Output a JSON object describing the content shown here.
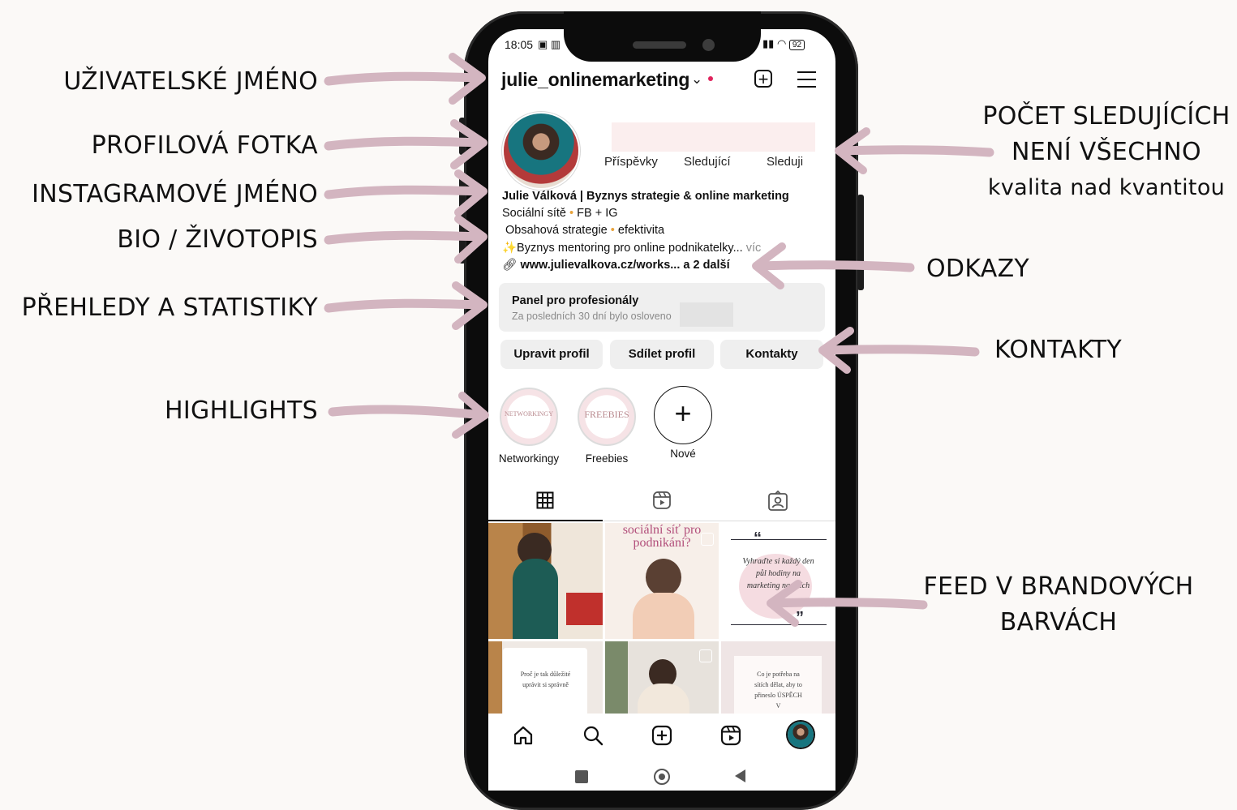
{
  "labels": {
    "username": "UŽIVATELSKÉ JMÉNO",
    "profile_photo": "PROFILOVÁ FOTKA",
    "instagram_name": "INSTAGRAMOVÉ JMÉNO",
    "bio": "BIO / ŽIVOTOPIS",
    "insights": "PŘEHLEDY A STATISTIKY",
    "highlights": "HIGHLIGHTS",
    "followers_line1": "POČET SLEDUJÍCÍCH",
    "followers_line2": "NENÍ VŠECHNO",
    "followers_line3": "kvalita nad kvantitou",
    "links": "ODKAZY",
    "contacts": "KONTAKTY",
    "feed_line1": "FEED V BRANDOVÝCH",
    "feed_line2": "BARVÁCH"
  },
  "status_bar": {
    "time": "18:05",
    "battery": "92"
  },
  "profile": {
    "username": "julie_onlinemarketing",
    "stats_labels": [
      "Příspěvky",
      "Sledující",
      "Sleduji"
    ],
    "display_name": "Julie Válková | Byznys strategie & online marketing",
    "bio_line2_a": "Sociální sítě",
    "bio_line2_b": "FB + IG",
    "bio_line3_a": "Obsahová strategie",
    "bio_line3_b": "efektivita",
    "bio_line4": "✨Byznys mentoring pro online podnikatelky...",
    "bio_more": "víc",
    "link": "www.julievalkova.cz/works... a 2 další"
  },
  "pro_panel": {
    "title": "Panel pro profesionály",
    "subtitle": "Za posledních 30 dní bylo osloveno"
  },
  "buttons": {
    "edit": "Upravit profil",
    "share": "Sdílet profil",
    "contacts": "Kontakty"
  },
  "highlights": [
    {
      "label": "Networkingy",
      "cover": "NETWORKINGY"
    },
    {
      "label": "Freebies",
      "cover": "FREEBIES"
    },
    {
      "label": "Nové",
      "cover": "+"
    }
  ],
  "feed": {
    "tile2": "sociální síť pro podnikání?",
    "tile3": "Vyhraďte si každý den půl hodiny na marketing na sítích",
    "tile4": "Proč je tak důležité uprávit si správně",
    "tile6": "Co je potřeba na sítích dělat, aby to přineslo ÚSPĚCH V"
  },
  "icons": {
    "grid": "grid-icon",
    "reels": "reels-icon",
    "tagged": "tagged-icon",
    "home": "home-icon",
    "search": "search-icon",
    "create": "create-icon",
    "profile": "profile-avatar"
  },
  "colors": {
    "arrow": "#d3b5c0",
    "highlight_ring": "#f6e3e6",
    "accent_dot": "#e8a33c"
  }
}
